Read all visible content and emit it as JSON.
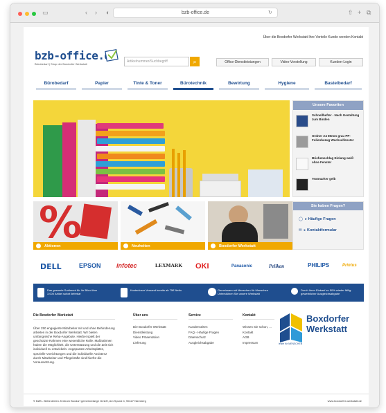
{
  "browser": {
    "url": "bzb-office.de",
    "back_icon": "chevron-left-icon",
    "forward_icon": "chevron-right-icon",
    "colors": {
      "close": "#ff5f57",
      "minimize": "#febc2e",
      "zoom": "#28c840"
    }
  },
  "header": {
    "top_links": "Über die Boxdorfer Werkstatt  Ihre Vorteile  Kunde werden  Kontakt",
    "logo_text": "bzb-office.de",
    "tagline": "Bürobedarf | Shop der Boxdorfer Werkstatt",
    "search_placeholder": "Artikelnummer/Suchbegriff",
    "buttons": [
      "Office-Dienstleistungen",
      "Video-Vorstellung",
      "Kunden-Login"
    ]
  },
  "nav": {
    "items": [
      "Bürobedarf",
      "Papier",
      "Tinte & Toner",
      "Bürotechnik",
      "Bewirtung",
      "Hygiene",
      "Bastelbedarf"
    ],
    "active_index": 3
  },
  "sidebar": {
    "title": "Unsere Favoriten",
    "items": [
      {
        "label": "Schnellhefter - Nach Gestaltung zum Binden"
      },
      {
        "label": "Ordner A4 80mm grau PP-Folienbezug Wechselfenster"
      },
      {
        "label": "Briefumschlag Einlang weiß ohne Fenster"
      },
      {
        "label": "Textmarker gelb"
      }
    ]
  },
  "tiles": [
    "Aktionen",
    "Neuheiten",
    "Boxdorfer Werkstatt"
  ],
  "questions": {
    "title": "Sie haben Fragen?",
    "items": [
      "Häufige Fragen",
      "Kontaktformular"
    ]
  },
  "brands": [
    "DELL",
    "EPSON",
    "infotec",
    "LEXMARK",
    "OKI",
    "Panasonic",
    "Pelikan",
    "PHILIPS",
    "Printus"
  ],
  "bluebar": [
    "Das gesamte Sortiment für Ihr Büro über 3.000 Artikel sofort lieferbar",
    "Kostenloser Versand bereits ab 75€ Netto",
    "Gemeinsam mit Menschen für Menschen Unterstützen Sie unsere Werkstatt",
    "Durch Ihren Einkauf zu 50% wieder fällig: gewerblicher Ausgleichsabgabe"
  ],
  "footer": {
    "about_title": "Die Boxdorfer Werkstatt",
    "about_text": "Über 250 engagierte Mitarbeiter mit und ohne Behinderung arbeiten in der Boxdorfer Werkstatt. Wir bieten umfangreiche Reha-Angebote. Hierbei spielt der geschützte Rahmen eine wesentliche Rolle. Maßnahmen haben die Möglichkeit, die Unterstützung und die Zeit sich individuell zu entwickeln. Angepasste Arbeitsplätze, spezielle Vorrichtungen und die individuelle Assistenz durch Mitarbeiter und Pflegekräfte sind hierfür die Voraussetzung.",
    "columns": [
      {
        "title": "Über uns",
        "links": [
          "Die Boxdorfer Werkstatt",
          "Dienstleistung",
          "Video Präsentation",
          "Lieferung"
        ]
      },
      {
        "title": "Service",
        "links": [
          "Kundenseiten",
          "FAQ - Häufige Fragen",
          "Datenschutz",
          "Ausgleichsabgabe"
        ]
      },
      {
        "title": "Kontakt",
        "links": [
          "Wissen Sie schon, ...",
          "Kontakt",
          "AGB",
          "Impressum"
        ]
      }
    ],
    "werkstatt_line1": "Boxdorfer",
    "werkstatt_line2": "Werkstatt",
    "werkstatt_sub": "leiste für MENSCHEN",
    "copyright": "© BZB - Behinderten Zentrum Boxdorf gemeinnützige GmbH, Am Spund 4, 90427 Nürnberg",
    "website": "www.boxdorfer-werkstatt.de"
  }
}
